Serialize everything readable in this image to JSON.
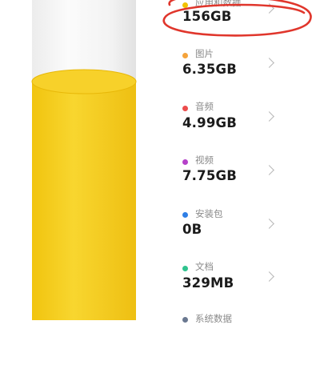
{
  "storage_items": [
    {
      "label": "应用和数据",
      "value": "156GB",
      "color": "#f2c200"
    },
    {
      "label": "图片",
      "value": "6.35GB",
      "color": "#f5a33a"
    },
    {
      "label": "音频",
      "value": "4.99GB",
      "color": "#ec4c4c"
    },
    {
      "label": "视频",
      "value": "7.75GB",
      "color": "#b541c9"
    },
    {
      "label": "安装包",
      "value": "0B",
      "color": "#2f7fe6"
    },
    {
      "label": "文档",
      "value": "329MB",
      "color": "#2fc38e"
    },
    {
      "label": "系统数据",
      "value": "",
      "color": "#6a7890"
    }
  ],
  "annotation": {
    "color": "#e0362c"
  },
  "cylinder": {
    "fill_color": "#f6cd1d",
    "empty_color": "#ffffff"
  }
}
